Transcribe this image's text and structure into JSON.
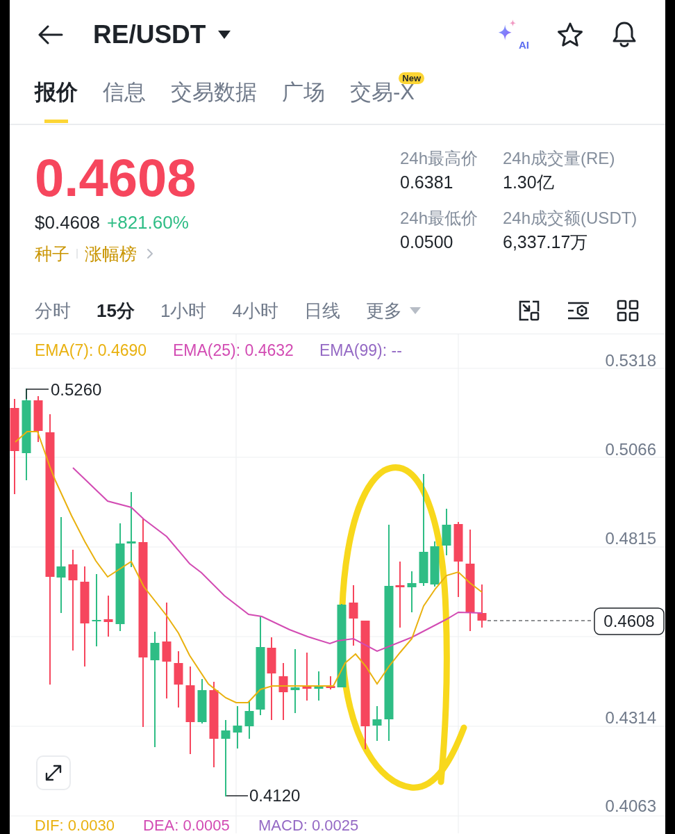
{
  "header": {
    "title": "RE/USDT",
    "ai_label": "AI"
  },
  "tabs": [
    {
      "label": "报价",
      "selected": true
    },
    {
      "label": "信息",
      "selected": false
    },
    {
      "label": "交易数据",
      "selected": false
    },
    {
      "label": "广场",
      "selected": false
    },
    {
      "label": "交易-X",
      "selected": false,
      "badge": "New"
    }
  ],
  "price": {
    "last": "0.4608",
    "usd": "$0.4608",
    "change": "+821.60%",
    "tags": [
      "种子",
      "涨幅榜"
    ]
  },
  "stats": [
    {
      "label": "24h最高价",
      "value": "0.6381"
    },
    {
      "label": "24h成交量(RE)",
      "value": "1.30亿"
    },
    {
      "label": "24h最低价",
      "value": "0.0500"
    },
    {
      "label": "24h成交额(USDT)",
      "value": "6,337.17万"
    }
  ],
  "intervals": [
    {
      "label": "分时",
      "selected": false,
      "kind": "interval"
    },
    {
      "label": "15分",
      "selected": true,
      "kind": "interval"
    },
    {
      "label": "1小时",
      "selected": false,
      "kind": "interval"
    },
    {
      "label": "4小时",
      "selected": false,
      "kind": "interval"
    },
    {
      "label": "日线",
      "selected": false,
      "kind": "interval"
    },
    {
      "label": "更多",
      "selected": false,
      "kind": "dropdown"
    }
  ],
  "chart": {
    "ema_legend": [
      {
        "label": "EMA(7): 0.4690",
        "color": "#e9b10f"
      },
      {
        "label": "EMA(25): 0.4632",
        "color": "#d24bb3"
      },
      {
        "label": "EMA(99): --",
        "color": "#9469c4"
      }
    ],
    "y_axis_labels": [
      "0.5318",
      "0.5066",
      "0.4815",
      "0.4314",
      "0.4063"
    ],
    "high_marker": "0.5260",
    "low_marker": "0.4120",
    "last_price": "0.4608",
    "macd_legend": [
      {
        "label": "DIF: 0.0030",
        "color": "#e9b10f"
      },
      {
        "label": "DEA: 0.0005",
        "color": "#d24bb3"
      },
      {
        "label": "MACD: 0.0025",
        "color": "#9469c4"
      }
    ]
  }
}
